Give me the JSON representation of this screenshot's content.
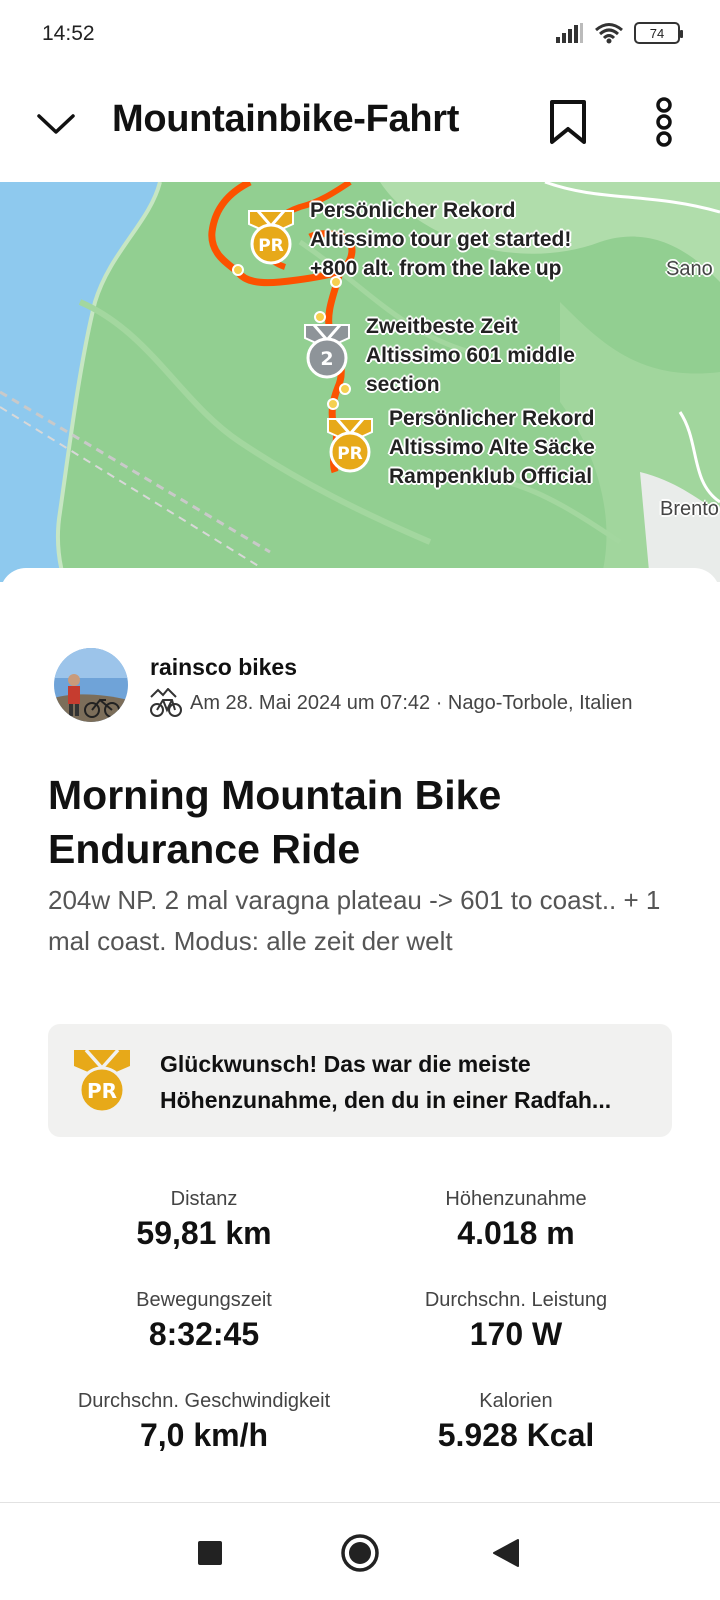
{
  "status_bar": {
    "time": "14:52",
    "battery": "74"
  },
  "header": {
    "title": "Mountainbike-Fahrt"
  },
  "map": {
    "segments": [
      {
        "medal": "PR",
        "lines": [
          "Persönlicher Rekord",
          "Altissimo tour get started!",
          "+800 alt. from the lake up"
        ]
      },
      {
        "medal": "2",
        "lines": [
          "Zweitbeste Zeit",
          "Altissimo 601 middle",
          "section"
        ]
      },
      {
        "medal": "PR",
        "lines": [
          "Persönlicher Rekord",
          "Altissimo Alte Säcke",
          "Rampenklub Official"
        ]
      }
    ],
    "places": [
      "Sano",
      "Brento"
    ]
  },
  "athlete": {
    "name": "rainsco bikes",
    "meta": "Am 28. Mai 2024 um 07:42 · Nago-Torbole, Italien"
  },
  "activity": {
    "title": "Morning Mountain Bike Endurance Ride",
    "description": "204w NP. 2 mal varagna plateau -> 601 to coast.. + 1 mal coast. Modus: alle zeit der welt"
  },
  "achievement": {
    "medal": "PR",
    "line1": "Glückwunsch! Das war die meiste",
    "line2": "Höhenzunahme, den du in einer Radfah..."
  },
  "stats": [
    {
      "label": "Distanz",
      "value": "59,81 km"
    },
    {
      "label": "Höhenzunahme",
      "value": "4.018 m"
    },
    {
      "label": "Bewegungszeit",
      "value": "8:32:45"
    },
    {
      "label": "Durchschn. Leistung",
      "value": "170 W"
    },
    {
      "label": "Durchschn. Geschwindigkeit",
      "value": "7,0 km/h"
    },
    {
      "label": "Kalorien",
      "value": "5.928 Kcal"
    }
  ],
  "colors": {
    "route": "#fc5200",
    "pr_gold": "#e7a919",
    "silver": "#8e9499",
    "map_green": "#8fcf8f",
    "water": "#8ec9ee"
  }
}
